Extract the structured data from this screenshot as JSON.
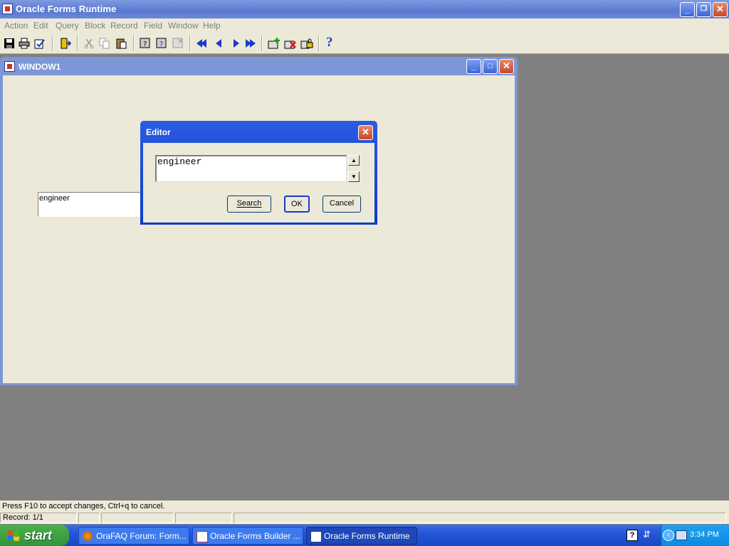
{
  "app": {
    "title": "Oracle Forms Runtime"
  },
  "menu": [
    "Action",
    "Edit",
    "Query",
    "Block",
    "Record",
    "Field",
    "Window",
    "Help"
  ],
  "toolbar": {
    "help_glyph": "?"
  },
  "window1": {
    "title": "WINDOW1",
    "field_value": "engineer"
  },
  "editor": {
    "title": "Editor",
    "text": "engineer",
    "search_label": "Search",
    "ok_label": "OK",
    "cancel_label": "Cancel"
  },
  "status": {
    "message": "Press F10  to accept changes, Ctrl+q  to cancel.",
    "record": "Record: 1/1"
  },
  "taskbar": {
    "start_label": "start",
    "tasks": [
      {
        "label": "OraFAQ Forum: Form..."
      },
      {
        "label": "Oracle Forms Builder ..."
      },
      {
        "label": "Oracle Forms Runtime"
      }
    ],
    "clock": "3:34 PM",
    "help_glyph": "?"
  },
  "colors": {
    "title_bar": "#5a78d0",
    "dialog_frame": "#0b3bcc",
    "face": "#ece9d8",
    "mdi_bg": "#808080",
    "taskbar": "#2456d8",
    "start": "#33943a"
  }
}
